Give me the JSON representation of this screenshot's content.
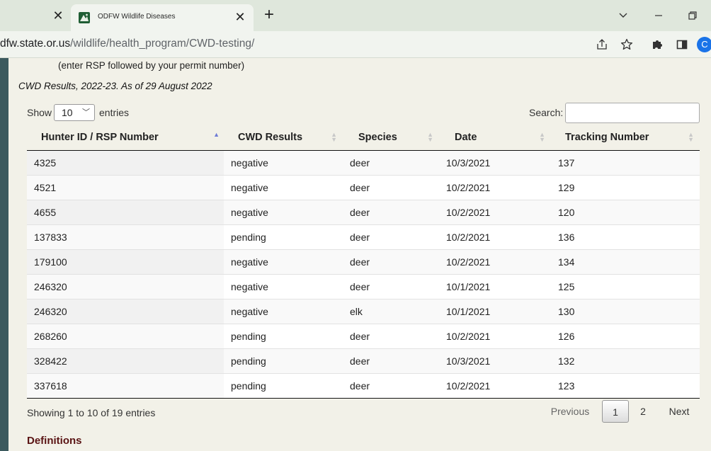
{
  "browser": {
    "tab_title": "ODFW Wildlife Diseases",
    "address_host": "dfw.state.or.us",
    "address_path": "/wildlife/health_program/CWD-testing/",
    "profile_initial": "C",
    "accent_color": "#1a73e8"
  },
  "page": {
    "hint": "(enter RSP followed by your permit number)",
    "caption": "CWD Results, 2022-23. As of 29 August 2022",
    "length_menu": {
      "prefix": "Show",
      "value": "10",
      "suffix": "entries"
    },
    "search_label": "Search:",
    "table": {
      "columns": [
        "Hunter ID / RSP Number",
        "CWD Results",
        "Species",
        "Date",
        "Tracking Number"
      ],
      "rows": [
        [
          "4325",
          "negative",
          "deer",
          "10/3/2021",
          "137"
        ],
        [
          "4521",
          "negative",
          "deer",
          "10/2/2021",
          "129"
        ],
        [
          "4655",
          "negative",
          "deer",
          "10/2/2021",
          "120"
        ],
        [
          "137833",
          "pending",
          "deer",
          "10/2/2021",
          "136"
        ],
        [
          "179100",
          "negative",
          "deer",
          "10/2/2021",
          "134"
        ],
        [
          "246320",
          "negative",
          "deer",
          "10/1/2021",
          "125"
        ],
        [
          "246320",
          "negative",
          "elk",
          "10/1/2021",
          "130"
        ],
        [
          "268260",
          "pending",
          "deer",
          "10/2/2021",
          "126"
        ],
        [
          "328422",
          "pending",
          "deer",
          "10/3/2021",
          "132"
        ],
        [
          "337618",
          "pending",
          "deer",
          "10/2/2021",
          "123"
        ]
      ]
    },
    "info": "Showing 1 to 10 of 19 entries",
    "pagination": {
      "previous": "Previous",
      "pages": [
        "1",
        "2"
      ],
      "next": "Next"
    },
    "definitions_heading": "Definitions",
    "heading_color": "#5a1414"
  }
}
